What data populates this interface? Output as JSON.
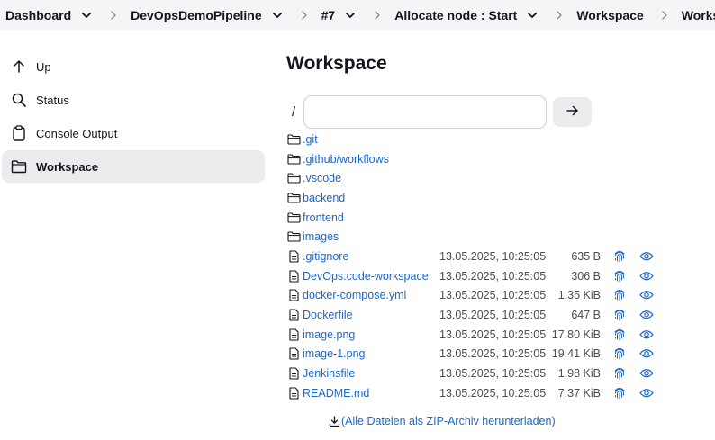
{
  "breadcrumb": [
    {
      "label": "Dashboard",
      "dropdown": true
    },
    {
      "label": "DevOpsDemoPipeline",
      "dropdown": true
    },
    {
      "label": "#7",
      "dropdown": true
    },
    {
      "label": "Allocate node : Start",
      "dropdown": true
    },
    {
      "label": "Workspace",
      "dropdown": false
    },
    {
      "label": "Workspace",
      "dropdown": false
    }
  ],
  "sidebar": {
    "items": [
      {
        "label": "Up",
        "icon": "arrow-up-icon",
        "active": false
      },
      {
        "label": "Status",
        "icon": "search-icon",
        "active": false
      },
      {
        "label": "Console Output",
        "icon": "clipboard-icon",
        "active": false
      },
      {
        "label": "Workspace",
        "icon": "folder-icon",
        "active": true
      }
    ]
  },
  "main": {
    "title": "Workspace",
    "path_prefix": "/",
    "path_value": "",
    "go_icon": "arrow-right-icon"
  },
  "files": [
    {
      "name": ".git",
      "type": "folder"
    },
    {
      "name": ".github/workflows",
      "type": "folder"
    },
    {
      "name": ".vscode",
      "type": "folder"
    },
    {
      "name": "backend",
      "type": "folder"
    },
    {
      "name": "frontend",
      "type": "folder"
    },
    {
      "name": "images",
      "type": "folder"
    },
    {
      "name": ".gitignore",
      "type": "file",
      "date": "13.05.2025, 10:25:05",
      "size": "635 B"
    },
    {
      "name": "DevOps.code-workspace",
      "type": "file",
      "date": "13.05.2025, 10:25:05",
      "size": "306 B"
    },
    {
      "name": "docker-compose.yml",
      "type": "file",
      "date": "13.05.2025, 10:25:05",
      "size": "1.35 KiB"
    },
    {
      "name": "Dockerfile",
      "type": "file",
      "date": "13.05.2025, 10:25:05",
      "size": "647 B"
    },
    {
      "name": "image.png",
      "type": "file",
      "date": "13.05.2025, 10:25:05",
      "size": "17.80 KiB"
    },
    {
      "name": "image-1.png",
      "type": "file",
      "date": "13.05.2025, 10:25:05",
      "size": "19.41 KiB"
    },
    {
      "name": "Jenkinsfile",
      "type": "file",
      "date": "13.05.2025, 10:25:05",
      "size": "1.98 KiB"
    },
    {
      "name": "README.md",
      "type": "file",
      "date": "13.05.2025, 10:25:05",
      "size": "7.37 KiB"
    }
  ],
  "zip_link": "(Alle Dateien als ZIP-Archiv herunterladen)",
  "colors": {
    "link": "#1e67c7",
    "text": "#14141f",
    "muted": "#4b4b59",
    "breadcrumb_bg": "#f5f5f7",
    "active_bg": "#ececef"
  }
}
